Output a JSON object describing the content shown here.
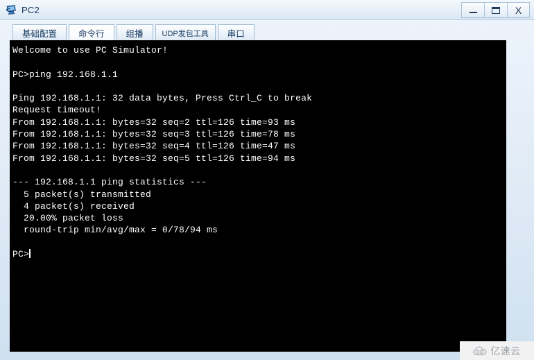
{
  "window": {
    "title": "PC2",
    "icon": "pc-monitor-icon",
    "controls": {
      "minimize_label": "—",
      "maximize_label": "▭",
      "close_label": "X"
    }
  },
  "tabs": [
    {
      "label": "基础配置",
      "active": false,
      "name": "tab-basic-config"
    },
    {
      "label": "命令行",
      "active": true,
      "name": "tab-command-line"
    },
    {
      "label": "组播",
      "active": false,
      "name": "tab-multicast"
    },
    {
      "label": "UDP发包工具",
      "active": false,
      "name": "tab-udp-tool",
      "small": true
    },
    {
      "label": "串口",
      "active": false,
      "name": "tab-serial-port"
    }
  ],
  "terminal": {
    "prompt": "PC>",
    "lines": [
      "Welcome to use PC Simulator!",
      "",
      "PC>ping 192.168.1.1",
      "",
      "Ping 192.168.1.1: 32 data bytes, Press Ctrl_C to break",
      "Request timeout!",
      "From 192.168.1.1: bytes=32 seq=2 ttl=126 time=93 ms",
      "From 192.168.1.1: bytes=32 seq=3 ttl=126 time=78 ms",
      "From 192.168.1.1: bytes=32 seq=4 ttl=126 time=47 ms",
      "From 192.168.1.1: bytes=32 seq=5 ttl=126 time=94 ms",
      "",
      "--- 192.168.1.1 ping statistics ---",
      "  5 packet(s) transmitted",
      "  4 packet(s) received",
      "  20.00% packet loss",
      "  round-trip min/avg/max = 0/78/94 ms",
      "",
      "PC>"
    ],
    "text": "Welcome to use PC Simulator!\n\nPC>ping 192.168.1.1\n\nPing 192.168.1.1: 32 data bytes, Press Ctrl_C to break\nRequest timeout!\nFrom 192.168.1.1: bytes=32 seq=2 ttl=126 time=93 ms\nFrom 192.168.1.1: bytes=32 seq=3 ttl=126 time=78 ms\nFrom 192.168.1.1: bytes=32 seq=4 ttl=126 time=47 ms\nFrom 192.168.1.1: bytes=32 seq=5 ttl=126 time=94 ms\n\n--- 192.168.1.1 ping statistics ---\n  5 packet(s) transmitted\n  4 packet(s) received\n  20.00% packet loss\n  round-trip min/avg/max = 0/78/94 ms\n\nPC>",
    "command": "ping 192.168.1.1",
    "target_ip": "192.168.1.1",
    "stats": {
      "transmitted": "5",
      "received": "4",
      "loss_percent": "20.00%",
      "min_ms": "0",
      "avg_ms": "78",
      "max_ms": "94"
    },
    "background": "#000000",
    "foreground": "#ffffff"
  },
  "watermark": {
    "text": "亿速云",
    "icon": "cloud-icon"
  }
}
